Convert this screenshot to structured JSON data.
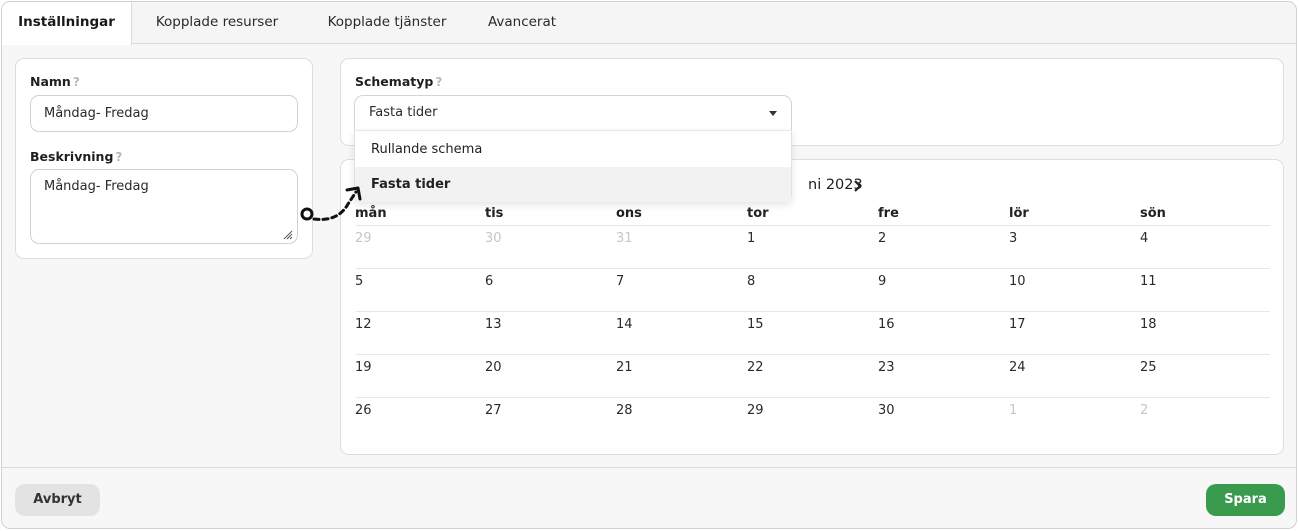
{
  "tabs": [
    "Inställningar",
    "Kopplade resurser",
    "Kopplade tjänster",
    "Avancerat"
  ],
  "help_symbol": "?",
  "name_field": {
    "label": "Namn",
    "value": "Måndag- Fredag"
  },
  "description_field": {
    "label": "Beskrivning",
    "value": "Måndag- Fredag"
  },
  "schedule_type": {
    "label": "Schematyp",
    "selected": "Fasta tider",
    "options": [
      "Rullande schema",
      "Fasta tider"
    ]
  },
  "calendar": {
    "month_label": "ni 2023",
    "weekdays": [
      "mån",
      "tis",
      "ons",
      "tor",
      "fre",
      "lör",
      "sön"
    ],
    "weeks": [
      [
        "29",
        "30",
        "31",
        "1",
        "2",
        "3",
        "4"
      ],
      [
        "5",
        "6",
        "7",
        "8",
        "9",
        "10",
        "11"
      ],
      [
        "12",
        "13",
        "14",
        "15",
        "16",
        "17",
        "18"
      ],
      [
        "19",
        "20",
        "21",
        "22",
        "23",
        "24",
        "25"
      ],
      [
        "26",
        "27",
        "28",
        "29",
        "30",
        "1",
        "2"
      ]
    ]
  },
  "footer": {
    "cancel_label": "Avbryt",
    "save_label": "Spara"
  },
  "colors": {
    "accent": "#3a9a4e",
    "annotation": "#111111"
  },
  "icons": [
    "resize-handle-icon",
    "dropdown-caret-icon",
    "chevron-right-icon",
    "annotation-arrow-icon"
  ]
}
